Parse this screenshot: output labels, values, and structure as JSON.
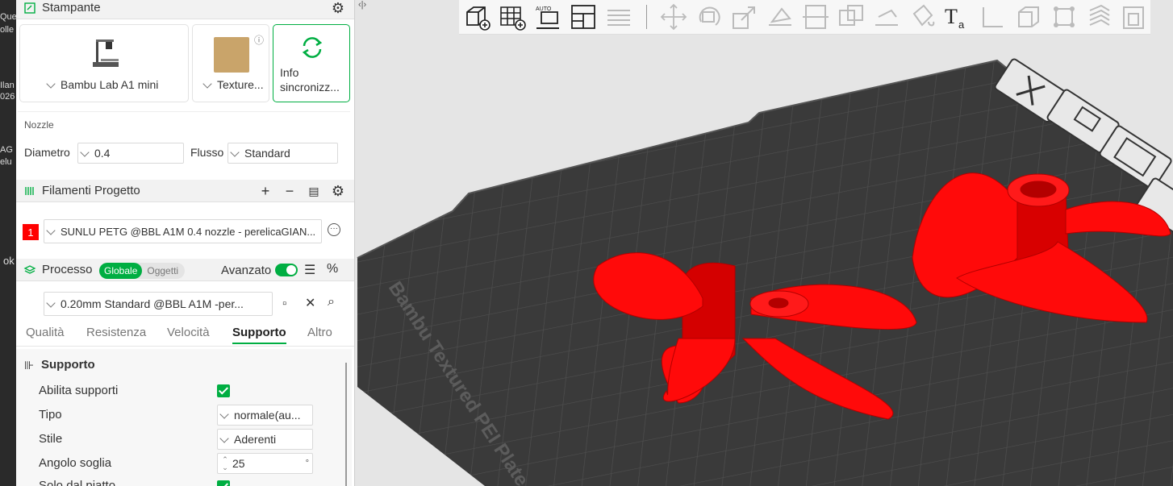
{
  "desktop": {
    "fragments": [
      "Que",
      "olle",
      "Ilan",
      "026",
      "AG",
      "elu",
      "ok"
    ]
  },
  "printer": {
    "title": "Stampante",
    "printer_name": "Bambu Lab A1 mini",
    "plate_name": "Texture...",
    "sync_label_line1": "Info",
    "sync_label_line2": "sincronizz...",
    "nozzle_section": "Nozzle",
    "diameter_label": "Diametro",
    "diameter_value": "0.4",
    "flow_label": "Flusso",
    "flow_value": "Standard"
  },
  "filaments": {
    "title": "Filamenti Progetto",
    "items": [
      {
        "index": "1",
        "name": "SUNLU PETG @BBL A1M 0.4 nozzle - perelicaGIAN...",
        "color": "#ff0000"
      }
    ]
  },
  "process": {
    "title": "Processo",
    "scope_global": "Globale",
    "scope_objects": "Oggetti",
    "advanced_label": "Avanzato",
    "profile": "0.20mm Standard @BBL A1M -per...",
    "tabs": [
      "Qualità",
      "Resistenza",
      "Velocità",
      "Supporto",
      "Altro"
    ],
    "active_tab": "Supporto"
  },
  "support": {
    "group_title": "Supporto",
    "enable_label": "Abilita supporti",
    "enable_checked": true,
    "type_label": "Tipo",
    "type_value": "normale(au...",
    "style_label": "Stile",
    "style_value": "Aderenti",
    "angle_label": "Angolo soglia",
    "angle_value": "25",
    "angle_unit": "°",
    "plate_only_label": "Solo dal piatto"
  },
  "plate": {
    "label": "Bambu Textured PEI Plate"
  },
  "colors": {
    "accent": "#00ae42",
    "model": "#ff0a0a",
    "plate": "#3a3a3a"
  }
}
